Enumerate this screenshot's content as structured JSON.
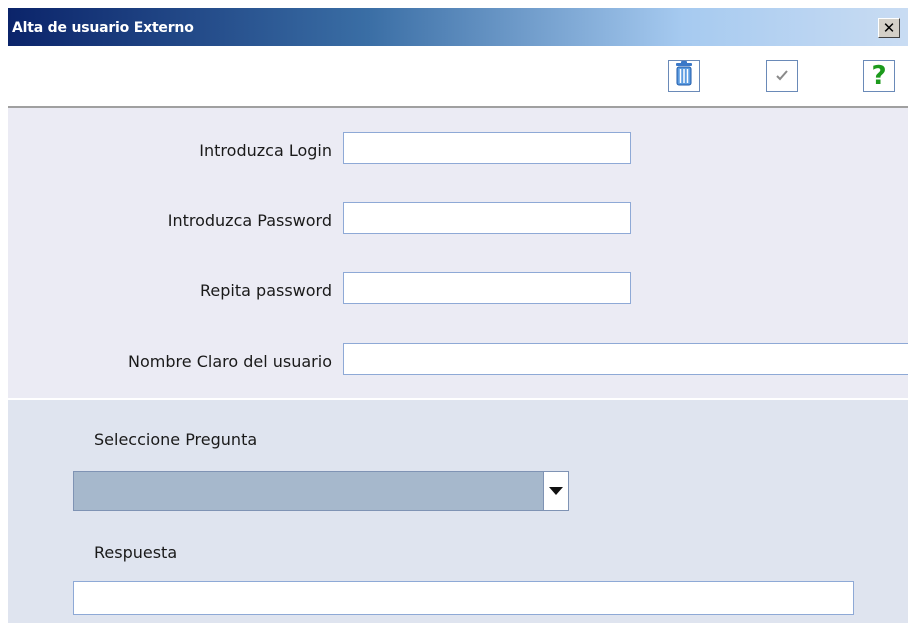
{
  "window": {
    "title": "Alta de usuario Externo",
    "close_label": "✕"
  },
  "toolbar": {
    "delete_icon": "trash-icon",
    "accept_icon": "check-icon",
    "help_icon": "question-icon",
    "help_label": "?"
  },
  "form": {
    "login_label": "Introduzca Login",
    "login_value": "",
    "password_label": "Introduzca Password",
    "password_value": "",
    "repeat_label": "Repita password",
    "repeat_value": "",
    "fullname_label": "Nombre Claro del usuario",
    "fullname_value": ""
  },
  "question": {
    "select_label": "Seleccione Pregunta",
    "selected_value": "",
    "answer_label": "Respuesta",
    "answer_value": ""
  },
  "colors": {
    "title_start": "#0b246a",
    "title_end": "#c9dcf3",
    "form_bg": "#ebebf4",
    "question_bg": "#dfe4ef",
    "help_green": "#1c9a1c"
  }
}
